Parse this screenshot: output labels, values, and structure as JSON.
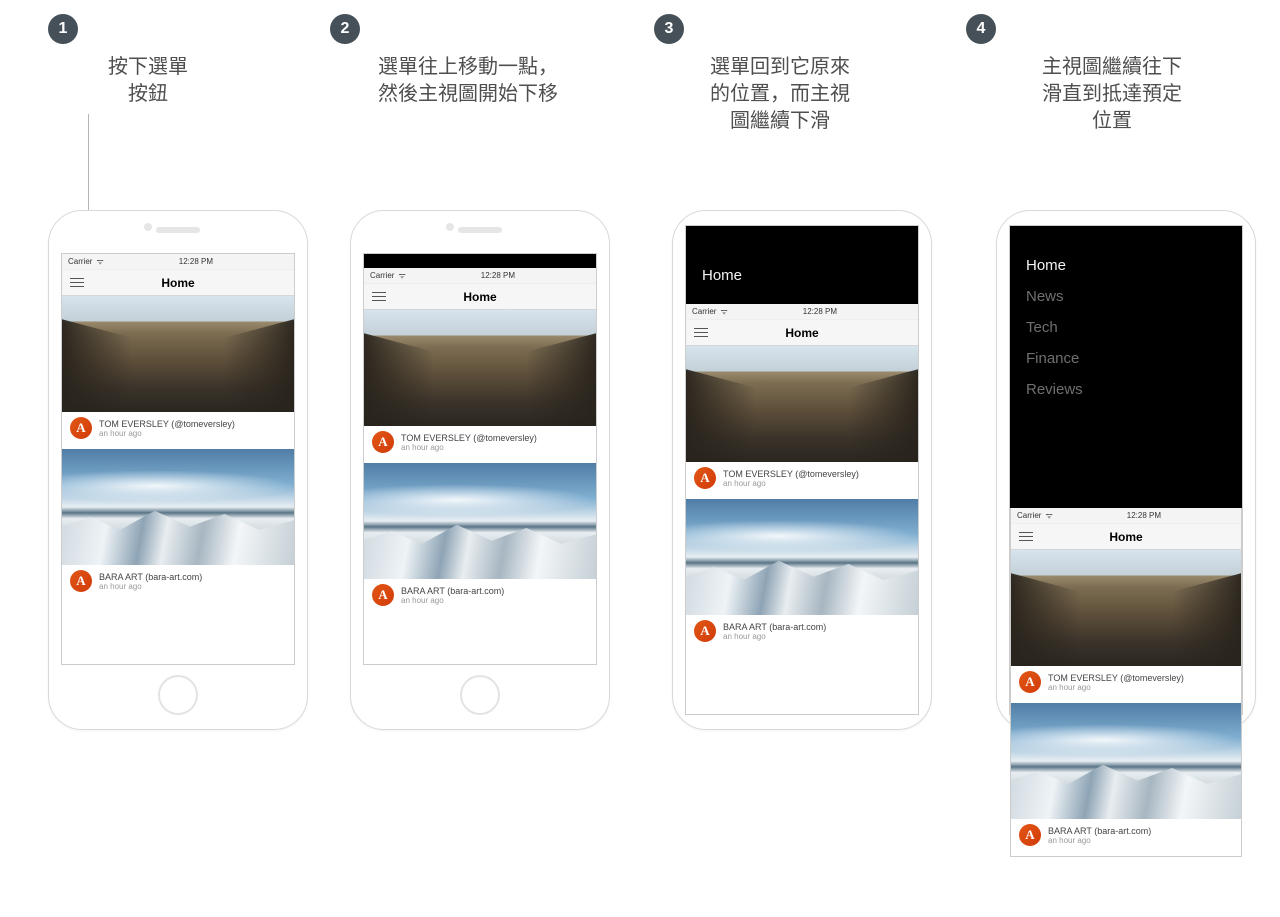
{
  "badges": {
    "s1": "1",
    "s2": "2",
    "s3": "3",
    "s4": "4"
  },
  "captions": {
    "s1": "按下選單\n按鈕",
    "s2": "選單往上移動一點，\n然後主視圖開始下移",
    "s3": "選單回到它原來\n的位置，而主視\n圖繼續下滑",
    "s4": "主視圖繼續往下\n滑直到抵達預定\n位置"
  },
  "status": {
    "carrier": "Carrier",
    "wifi": "ᯤ",
    "time": "12:28 PM"
  },
  "nav": {
    "title": "Home"
  },
  "menu": {
    "items": [
      {
        "label": "Home",
        "active": true
      },
      {
        "label": "News",
        "active": false
      },
      {
        "label": "Tech",
        "active": false
      },
      {
        "label": "Finance",
        "active": false
      },
      {
        "label": "Reviews",
        "active": false
      }
    ]
  },
  "posts": [
    {
      "avatar": "A",
      "name": "TOM EVERSLEY (@tomeversley)",
      "time": "an hour ago"
    },
    {
      "avatar": "A",
      "name": "BARA ART (bara-art.com)",
      "time": "an hour ago"
    }
  ]
}
